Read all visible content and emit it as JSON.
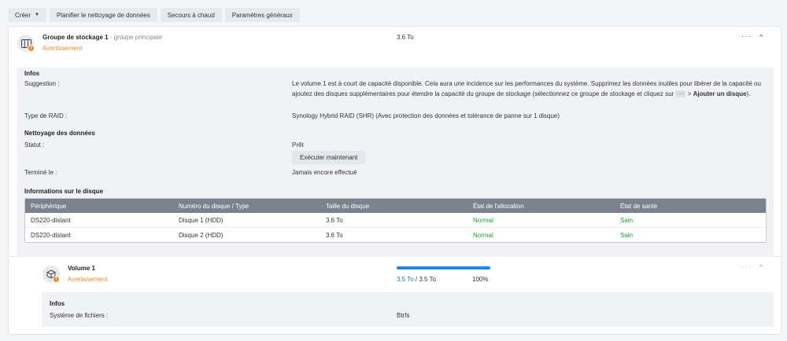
{
  "toolbar": {
    "create": "Créer",
    "schedule": "Planifier le nettoyage de données",
    "hot_spare": "Secours à chaud",
    "settings": "Paramètres généraux"
  },
  "pool": {
    "title": "Groupe de stockage 1",
    "subtitle": "- groupe principale",
    "status": "Avertissement",
    "capacity": "3.6 To",
    "info": {
      "heading": "Infos",
      "suggestion_label": "Suggestion :",
      "suggestion_text": "Le volume 1 est à court de capacité disponible. Cela aura une incidence sur les performances du système. Supprimez les données inutiles pour libérer de la capacité ou ajoutez des disques supplémentaires pour étendre la capacité du groupe de stockage (sélectionnez ce groupe de stockage et cliquez sur",
      "suggestion_more": "···",
      "suggestion_sep": ">",
      "suggestion_action": "Ajouter un disque",
      "suggestion_end": ").",
      "raid_label": "Type de RAID :",
      "raid_value": "Synology Hybrid RAID (SHR) (Avec protection des données et tolérance de panne sur 1 disque)"
    },
    "scrub": {
      "heading": "Nettoyage des données",
      "status_label": "Statut :",
      "status_value": "Prêt",
      "run_button": "Exécuter maintenant",
      "finished_label": "Terminé le :",
      "finished_value": "Jamais encore effectué"
    },
    "disks": {
      "heading": "Informations sur le disque",
      "columns": [
        "Périphérique",
        "Numéro du disque / Type",
        "Taille du disque",
        "État de l'allocation",
        "État de santé"
      ],
      "rows": [
        [
          "DS220-distant",
          "Disque 1 (HDD)",
          "3.6 To",
          "Normal",
          "Sain"
        ],
        [
          "DS220-distant",
          "Disque 2 (HDD)",
          "3.6 To",
          "Normal",
          "Sain"
        ]
      ]
    }
  },
  "volume": {
    "title": "Volume 1",
    "status": "Avertissement",
    "used": "3.5 To",
    "sep": "/",
    "total": "3.5 To",
    "percent": "100%",
    "usage_fraction": 1.0,
    "info": {
      "heading": "Infos",
      "fs_label": "Système de fichiers :",
      "fs_value": "Btrfs"
    }
  },
  "icons": {
    "more": "···",
    "collapse": "^",
    "warning": "!",
    "caret": "▼"
  },
  "colors": {
    "warning": "#f0891f",
    "healthy": "#1a9e35",
    "progress": "#1e88e5",
    "table_header": "#7c828b"
  }
}
